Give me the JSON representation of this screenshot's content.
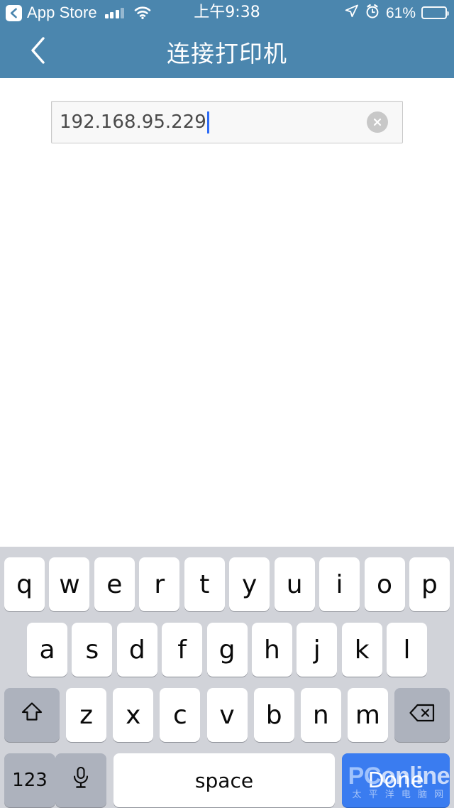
{
  "colors": {
    "nav_bar": "#4b86ae",
    "status_bar": "#4b86ae",
    "keyboard_bg": "#d1d3d9",
    "key_white": "#ffffff",
    "key_mod_gray": "#adb2bd",
    "done_blue": "#3a7cf0",
    "caret_blue": "#2e6cf6",
    "field_bg": "#f8f8f8",
    "clear_gray": "#c8c8c8"
  },
  "status_bar": {
    "back_app_label": "App Store",
    "back_icon": "chevron-left-boxed-icon",
    "signal_icon": "cellular-signal-icon",
    "signal_bars_filled": 3,
    "signal_bars_total": 4,
    "wifi_icon": "wifi-icon",
    "time": "上午9:38",
    "location_icon": "location-arrow-icon",
    "alarm_icon": "alarm-clock-icon",
    "battery_percent": "61%",
    "battery_level": 61,
    "battery_icon": "battery-icon"
  },
  "nav_bar": {
    "back_icon": "chevron-left-icon",
    "title": "连接打印机"
  },
  "content": {
    "ip_field": {
      "value": "192.168.95.229",
      "placeholder": "",
      "clear_icon": "clear-circle-x-icon",
      "caret_visible": true
    }
  },
  "keyboard": {
    "row1": [
      "q",
      "w",
      "e",
      "r",
      "t",
      "y",
      "u",
      "i",
      "o",
      "p"
    ],
    "row2": [
      "a",
      "s",
      "d",
      "f",
      "g",
      "h",
      "j",
      "k",
      "l"
    ],
    "row3": [
      "z",
      "x",
      "c",
      "v",
      "b",
      "n",
      "m"
    ],
    "shift_icon": "shift-arrow-icon",
    "backspace_icon": "backspace-delete-icon",
    "numbers_label": "123",
    "mic_icon": "microphone-icon",
    "space_label": "space",
    "done_label": "Done"
  },
  "watermark": {
    "brand_pc": "PC",
    "brand_online": "online",
    "subtitle": "太 平 洋 电 脑 网"
  }
}
